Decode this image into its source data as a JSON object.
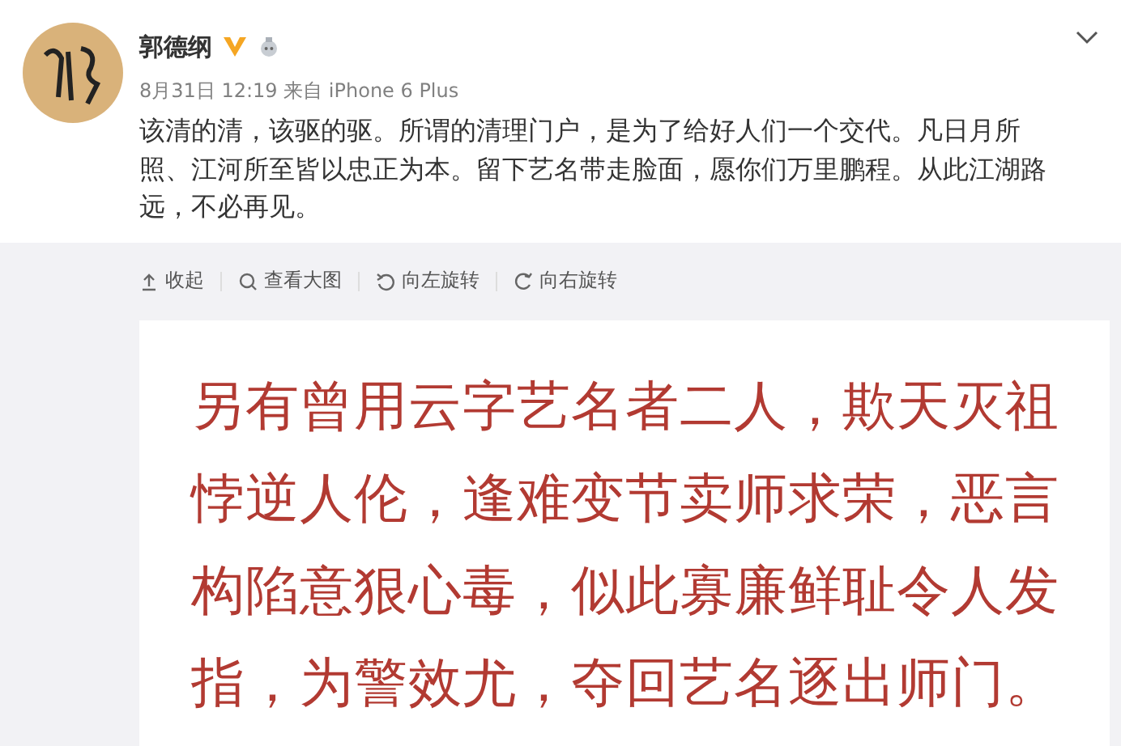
{
  "post": {
    "author": "郭德纲",
    "verified": true,
    "meta": "8月31日 12:19 来自 iPhone 6 Plus",
    "text": "该清的清，该驱的驱。所谓的清理门户，是为了给好人们一个交代。凡日月所照、江河所至皆以忠正为本。留下艺名带走脸面，愿你们万里鹏程。从此江湖路远，不必再见。"
  },
  "image_actions": [
    {
      "kind": "collapse",
      "label": "收起"
    },
    {
      "kind": "zoom",
      "label": "查看大图"
    },
    {
      "kind": "rotate-left",
      "label": "向左旋转"
    },
    {
      "kind": "rotate-right",
      "label": "向右旋转"
    }
  ],
  "image_text": [
    "另有曾用云字艺名者二人，欺天灭祖",
    "悖逆人伦，逢难变节卖师求荣，恶言",
    "构陷意狠心毒，似此寡廉鲜耻令人发",
    "指，为警效尤，夺回艺名逐出师门。"
  ]
}
